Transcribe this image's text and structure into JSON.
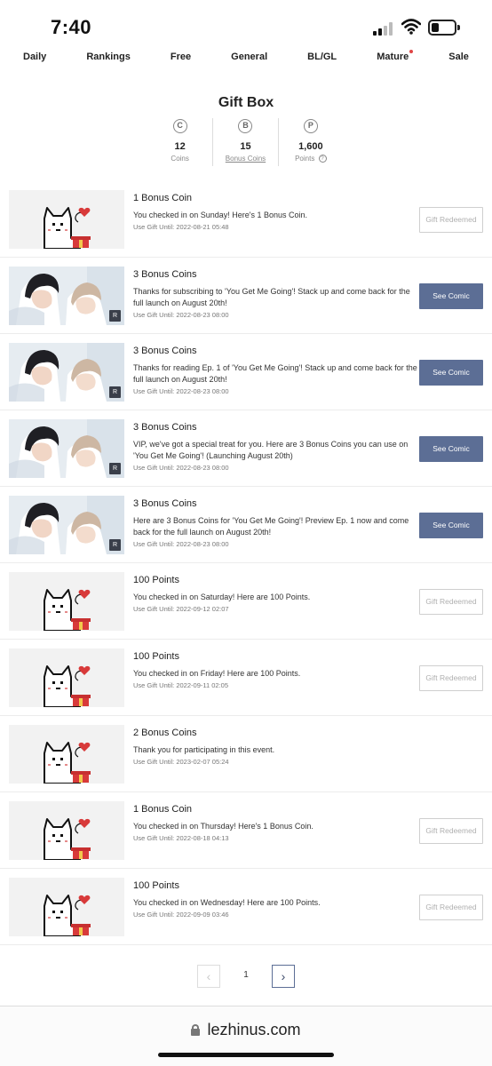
{
  "status_bar": {
    "time": "7:40"
  },
  "nav": {
    "items": [
      "Daily",
      "Rankings",
      "Free",
      "General",
      "BL/GL",
      "Mature",
      "Sale"
    ]
  },
  "gift_box": {
    "title": "Gift Box",
    "stats": [
      {
        "icon": "C",
        "value": "12",
        "label": "Coins"
      },
      {
        "icon": "B",
        "value": "15",
        "label": "Bonus Coins"
      },
      {
        "icon": "P",
        "value": "1,600",
        "label": "Points"
      }
    ]
  },
  "gifts": [
    {
      "title": "1 Bonus Coin",
      "description": "You checked in on Sunday! Here's 1 Bonus Coin.",
      "date": "Use Gift Until: 2022-08-21 05:48",
      "action": "Gift Redeemed",
      "thumb": "mascot"
    },
    {
      "title": "3 Bonus Coins",
      "description": "Thanks for subscribing to 'You Get Me Going'! Stack up and come back for the full launch on August 20th!",
      "date": "Use Gift Until: 2022-08-23 08:00",
      "action": "See Comic",
      "thumb": "comic",
      "badge": "R"
    },
    {
      "title": "3 Bonus Coins",
      "description": "Thanks for reading Ep. 1 of 'You Get Me Going'! Stack up and come back for the full launch on August 20th!",
      "date": "Use Gift Until: 2022-08-23 08:00",
      "action": "See Comic",
      "thumb": "comic",
      "badge": "R"
    },
    {
      "title": "3 Bonus Coins",
      "description": "VIP, we've got a special treat for you. Here are 3 Bonus Coins you can use on 'You Get Me Going'! (Launching August 20th)",
      "date": "Use Gift Until: 2022-08-23 08:00",
      "action": "See Comic",
      "thumb": "comic",
      "badge": "R"
    },
    {
      "title": "3 Bonus Coins",
      "description": "Here are 3 Bonus Coins for 'You Get Me Going'! Preview Ep. 1 now and come back for the full launch on August 20th!",
      "date": "Use Gift Until: 2022-08-23 08:00",
      "action": "See Comic",
      "thumb": "comic",
      "badge": "R"
    },
    {
      "title": "100 Points",
      "description": "You checked in on Saturday! Here are 100 Points.",
      "date": "Use Gift Until: 2022-09-12 02:07",
      "action": "Gift Redeemed",
      "thumb": "mascot"
    },
    {
      "title": "100 Points",
      "description": "You checked in on Friday! Here are 100 Points.",
      "date": "Use Gift Until: 2022-09-11 02:05",
      "action": "Gift Redeemed",
      "thumb": "mascot"
    },
    {
      "title": "2 Bonus Coins",
      "description": "Thank you for participating in this event.",
      "date": "Use Gift Until: 2023-02-07 05:24",
      "action": "",
      "thumb": "mascot"
    },
    {
      "title": "1 Bonus Coin",
      "description": "You checked in on Thursday! Here's 1 Bonus Coin.",
      "date": "Use Gift Until: 2022-08-18 04:13",
      "action": "Gift Redeemed",
      "thumb": "mascot"
    },
    {
      "title": "100 Points",
      "description": "You checked in on Wednesday! Here are 100 Points.",
      "date": "Use Gift Until: 2022-09-09 03:46",
      "action": "Gift Redeemed",
      "thumb": "mascot"
    }
  ],
  "pagination": {
    "prev": "‹",
    "current": "1",
    "next": "›"
  },
  "url_bar": {
    "url": "lezhinus.com"
  },
  "colors": {
    "accent": "#5c6e95",
    "mature_dot": "#e04545",
    "heart": "#d83a3a",
    "gift_box": "#d83a3a"
  }
}
